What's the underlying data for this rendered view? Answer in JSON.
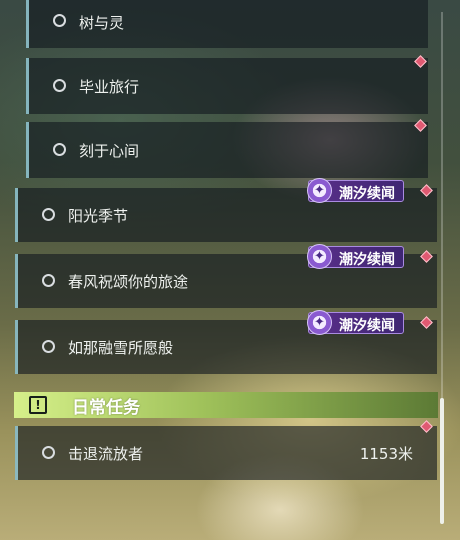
{
  "quests": [
    {
      "title": "树与灵"
    },
    {
      "title": "毕业旅行"
    },
    {
      "title": "刻于心间"
    },
    {
      "title": "阳光季节",
      "tag": "潮汐续闻"
    },
    {
      "title": "春风祝颂你的旅途",
      "tag": "潮汐续闻"
    },
    {
      "title": "如那融雪所愿般",
      "tag": "潮汐续闻"
    }
  ],
  "daily_section": {
    "icon": "!",
    "title": "日常任务",
    "items": [
      {
        "title": "击退流放者",
        "distance": "1153米"
      }
    ]
  },
  "icons": {
    "quest_status": "circle-icon",
    "marker": "diamond-marker-icon",
    "tag": "tide-story-icon",
    "section": "alert-icon"
  },
  "colors": {
    "accent_border": "#96cdd7",
    "marker": "#e05a72",
    "tag_bg": "#5a2f8a",
    "section_header": "#c5e47a"
  }
}
